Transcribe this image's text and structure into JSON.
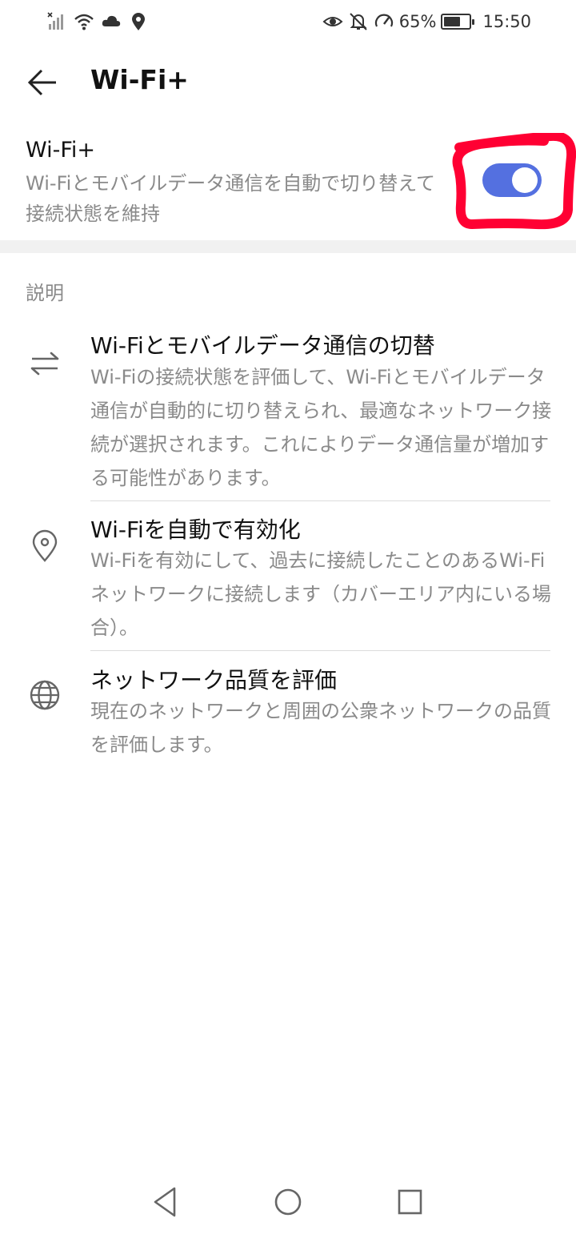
{
  "status_bar": {
    "battery_percent": "65%",
    "battery_level": 0.65,
    "time": "15:50",
    "icons": [
      "signal-icon",
      "wifi-icon",
      "cloud-icon",
      "location-icon",
      "eye-icon",
      "bell-off-icon",
      "speed-icon",
      "battery-icon"
    ]
  },
  "header": {
    "title": "Wi-Fi+",
    "back_icon": "arrow-left-icon"
  },
  "main_setting": {
    "title": "Wi-Fi+",
    "description": "Wi-Fiとモバイルデータ通信を自動で切り替えて接続状態を維持",
    "toggle_on": true,
    "accent_color": "#5470e0",
    "annotation_color": "#ff0033"
  },
  "section": {
    "header": "説明"
  },
  "items": [
    {
      "icon": "swap-arrows-icon",
      "title": "Wi-Fiとモバイルデータ通信の切替",
      "description": "Wi-Fiの接続状態を評価して、Wi-Fiとモバイルデータ通信が自動的に切り替えられ、最適なネットワーク接続が選択されます。これによりデータ通信量が増加する可能性があります。"
    },
    {
      "icon": "location-pin-icon",
      "title": "Wi-Fiを自動で有効化",
      "description": "Wi-Fiを有効にして、過去に接続したことのあるWi-Fiネットワークに接続します（カバーエリア内にいる場合）。"
    },
    {
      "icon": "globe-icon",
      "title": "ネットワーク品質を評価",
      "description": "現在のネットワークと周囲の公衆ネットワークの品質を評価します。"
    }
  ],
  "nav_bar": {
    "icons": [
      "back-triangle-icon",
      "home-circle-icon",
      "recents-square-icon"
    ]
  }
}
